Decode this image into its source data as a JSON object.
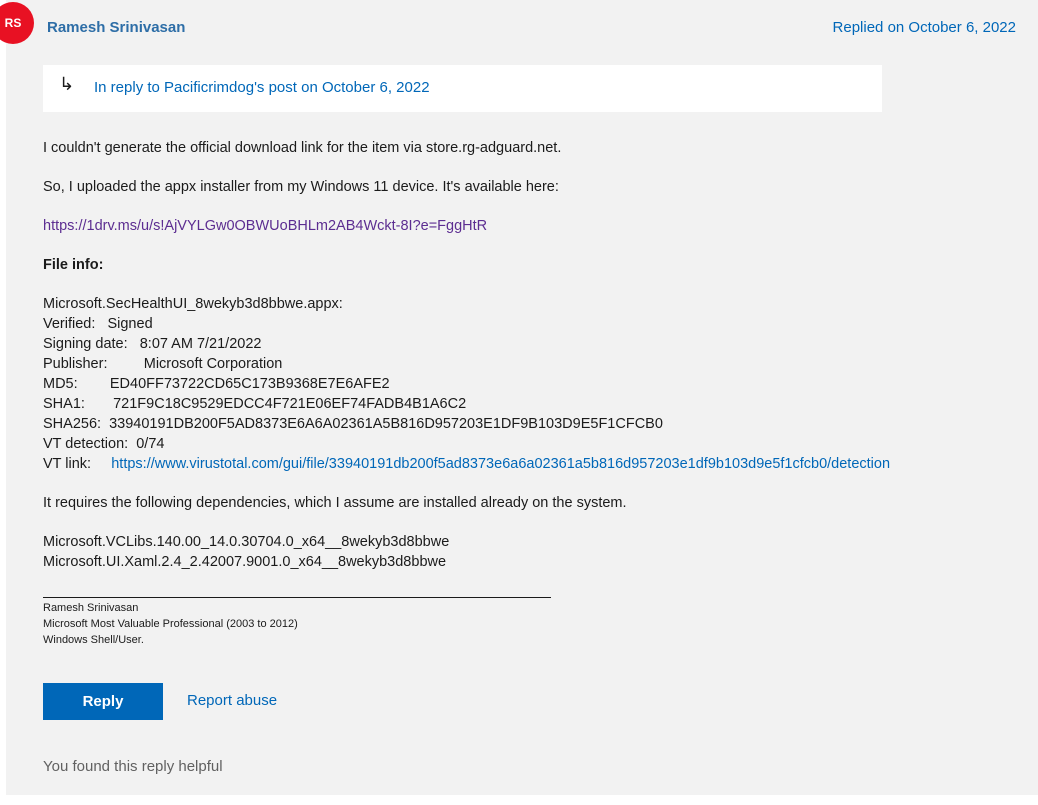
{
  "post": {
    "avatar_initials": "RS",
    "author": "Ramesh Srinivasan",
    "replied_on": "Replied on October 6, 2022",
    "in_reply_to": "In reply to Pacificrimdog's post on October 6, 2022",
    "body": {
      "line1": "I couldn't generate the official download link for the item via store.rg-adguard.net.",
      "line2": "So, I uploaded the appx installer from my Windows 11 device. It's available here:",
      "download_link": "https://1drv.ms/u/s!AjVYLGw0OBWUoBHLm2AB4Wckt-8I?e=FggHtR",
      "file_info_heading": "File info:",
      "file_name": "Microsoft.SecHealthUI_8wekyb3d8bbwe.appx:",
      "verified": "Verified:   Signed",
      "signing_date": "Signing date:   8:07 AM 7/21/2022",
      "publisher": "Publisher:         Microsoft Corporation",
      "md5": "MD5:        ED40FF73722CD65C173B9368E7E6AFE2",
      "sha1": "SHA1:       721F9C18C9529EDCC4F721E06EF74FADB4B1A6C2",
      "sha256": "SHA256:  33940191DB200F5AD8373E6A6A02361A5B816D957203E1DF9B103D9E5F1CFCB0",
      "vt_detection": "VT detection:  0/74",
      "vt_link_label": "VT link:     ",
      "vt_link": "https://www.virustotal.com/gui/file/33940191db200f5ad8373e6a6a02361a5b816d957203e1df9b103d9e5f1cfcb0/detection",
      "dependencies_text": "It requires the following dependencies, which I assume are installed already on the system.",
      "dep1": "Microsoft.VCLibs.140.00_14.0.30704.0_x64__8wekyb3d8bbwe",
      "dep2": "Microsoft.UI.Xaml.2.4_2.42007.9001.0_x64__8wekyb3d8bbwe"
    },
    "signature": {
      "name": "Ramesh Srinivasan",
      "title": "Microsoft Most Valuable Professional (2003 to 2012)",
      "area": "Windows Shell/User."
    },
    "actions": {
      "reply": "Reply",
      "report_abuse": "Report abuse"
    },
    "helpful_text": "You found this reply helpful"
  },
  "colors": {
    "accent": "#0067b8",
    "avatar": "#e81123",
    "visited_link": "#5c2d91"
  }
}
